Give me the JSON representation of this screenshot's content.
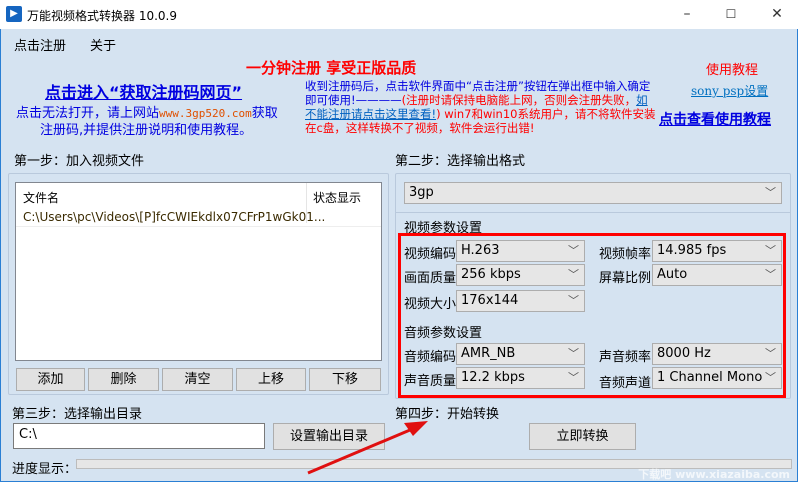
{
  "window": {
    "title": "万能视频格式转换器 10.0.9",
    "icon": "app-logo-icon",
    "controls": {
      "minimize": "–",
      "maximize": "☐",
      "close": "✕"
    }
  },
  "menu": [
    "点击注册",
    "关于"
  ],
  "promo": {
    "headline": "一分钟注册  享受正版品质",
    "get_code_link": "点击进入“获取注册码网页”",
    "fallback_line1_a": "点击无法打开，请上网站",
    "fallback_site": "www.3gp520.com",
    "fallback_line1_b": "获取",
    "fallback_line2": "注册码,并提供注册说明和使用教程。",
    "notice_1": "收到注册码后，点击软件界面中“点击注册”按钮在弹出框中输入确定即可使用!————",
    "notice_2": "(注册时请保持电脑能上网，否则会注册失败，",
    "notice_link": "如不能注册请点击这里查看!",
    "notice_3": ") win7和win10系统用户，请不将软件安装在c盘，这样转换不了视频，软件会运行出错!",
    "tutorial_label": "使用教程",
    "sony_link": "sony psp设置",
    "tutorial_link": "点击查看使用教程"
  },
  "step1": {
    "label": "第一步：加入视频文件",
    "columns": [
      "文件名",
      "状态显示"
    ],
    "files": [
      {
        "name": "C:\\Users\\pc\\Videos\\[P]fcCWIEkdlx07CFrP1wGk01...",
        "status": ""
      }
    ],
    "buttons": [
      "添加",
      "删除",
      "清空",
      "上移",
      "下移"
    ]
  },
  "step2": {
    "label": "第二步：选择输出格式",
    "format": "3gp",
    "video_section": "视频参数设置",
    "video": {
      "codec_label": "视频编码",
      "codec": "H.263",
      "fps_label": "视频帧率",
      "fps": "14.985 fps",
      "quality_label": "画面质量",
      "quality": "256 kbps",
      "aspect_label": "屏幕比例",
      "aspect": "Auto",
      "size_label": "视频大小",
      "size": "176x144"
    },
    "audio_section": "音频参数设置",
    "audio": {
      "codec_label": "音频编码",
      "codec": "AMR_NB",
      "rate_label": "声音频率",
      "rate": "8000 Hz",
      "quality_label": "声音质量",
      "quality": "12.2 kbps",
      "channel_label": "音频声道",
      "channel": "1 Channel Mono"
    }
  },
  "step3": {
    "label": "第三步：选择输出目录",
    "path": "C:\\",
    "button": "设置输出目录"
  },
  "step4": {
    "label": "第四步：开始转换",
    "button": "立即转换"
  },
  "progress": {
    "label": "进度显示：",
    "value": 0
  },
  "colors": {
    "highlight": "#ff0000",
    "link": "#0000e0",
    "bg": "#d5e3f1"
  },
  "watermark": "下载吧 www.xiazaiba.com"
}
